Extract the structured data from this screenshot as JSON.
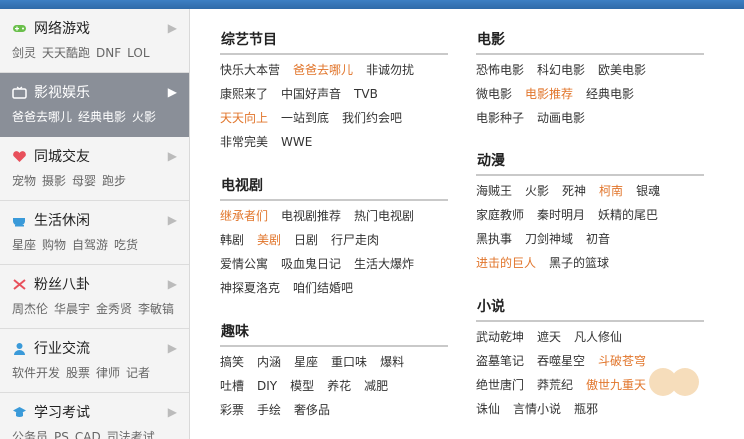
{
  "sidebar": {
    "items": [
      {
        "title": "网络游戏",
        "links": [
          "剑灵",
          "天天酷跑",
          "DNF",
          "LOL"
        ],
        "icon": "gamepad-icon",
        "color": "#6abf4b"
      },
      {
        "title": "影视娱乐",
        "links": [
          "爸爸去哪儿",
          "经典电影",
          "火影"
        ],
        "icon": "tv-icon",
        "color": "#ffffff"
      },
      {
        "title": "同城交友",
        "links": [
          "宠物",
          "摄影",
          "母婴",
          "跑步"
        ],
        "icon": "heart-icon",
        "color": "#e8505b"
      },
      {
        "title": "生活休闲",
        "links": [
          "星座",
          "购物",
          "自驾游",
          "吃货"
        ],
        "icon": "cup-icon",
        "color": "#3a9ad9"
      },
      {
        "title": "粉丝八卦",
        "links": [
          "周杰伦",
          "华晨宇",
          "金秀贤",
          "李敏镐"
        ],
        "icon": "cross-icon",
        "color": "#e8505b"
      },
      {
        "title": "行业交流",
        "links": [
          "软件开发",
          "股票",
          "律师",
          "记者"
        ],
        "icon": "person-icon",
        "color": "#3a9ad9"
      },
      {
        "title": "学习考试",
        "links": [
          "公务员",
          "PS",
          "CAD",
          "司法考试"
        ],
        "icon": "graduation-cap-icon",
        "color": "#3a9ad9"
      }
    ]
  },
  "sections": {
    "variety": {
      "title": "综艺节目",
      "rows": [
        [
          {
            "t": "快乐大本营"
          },
          {
            "t": "爸爸去哪儿",
            "hl": true
          },
          {
            "t": "非诚勿扰"
          }
        ],
        [
          {
            "t": "康熙来了"
          },
          {
            "t": "中国好声音"
          },
          {
            "t": "TVB"
          }
        ],
        [
          {
            "t": "天天向上",
            "hl": true
          },
          {
            "t": "一站到底"
          },
          {
            "t": "我们约会吧"
          }
        ],
        [
          {
            "t": "非常完美"
          },
          {
            "t": "WWE"
          }
        ]
      ]
    },
    "tvdrama": {
      "title": "电视剧",
      "rows": [
        [
          {
            "t": "继承者们",
            "hl": true
          },
          {
            "t": "电视剧推荐"
          },
          {
            "t": "热门电视剧"
          }
        ],
        [
          {
            "t": "韩剧"
          },
          {
            "t": "美剧",
            "hl": true
          },
          {
            "t": "日剧"
          },
          {
            "t": "行尸走肉"
          }
        ],
        [
          {
            "t": "爱情公寓"
          },
          {
            "t": "吸血鬼日记"
          },
          {
            "t": "生活大爆炸"
          }
        ],
        [
          {
            "t": "神探夏洛克"
          },
          {
            "t": "咱们结婚吧"
          }
        ]
      ]
    },
    "fun": {
      "title": "趣味",
      "rows": [
        [
          {
            "t": "搞笑"
          },
          {
            "t": "内涵"
          },
          {
            "t": "星座"
          },
          {
            "t": "重口味"
          },
          {
            "t": "爆料"
          }
        ],
        [
          {
            "t": "吐槽"
          },
          {
            "t": "DIY"
          },
          {
            "t": "模型"
          },
          {
            "t": "养花"
          },
          {
            "t": "减肥"
          }
        ],
        [
          {
            "t": "彩票"
          },
          {
            "t": "手绘"
          },
          {
            "t": "奢侈品"
          }
        ]
      ]
    },
    "movie": {
      "title": "电影",
      "rows": [
        [
          {
            "t": "恐怖电影"
          },
          {
            "t": "科幻电影"
          },
          {
            "t": "欧美电影"
          }
        ],
        [
          {
            "t": "微电影"
          },
          {
            "t": "电影推荐",
            "hl": true
          },
          {
            "t": "经典电影"
          }
        ],
        [
          {
            "t": "电影种子"
          },
          {
            "t": "动画电影"
          }
        ]
      ]
    },
    "anime": {
      "title": "动漫",
      "rows": [
        [
          {
            "t": "海贼王"
          },
          {
            "t": "火影"
          },
          {
            "t": "死神"
          },
          {
            "t": "柯南",
            "hl": true
          },
          {
            "t": "银魂"
          }
        ],
        [
          {
            "t": "家庭教师"
          },
          {
            "t": "秦时明月"
          },
          {
            "t": "妖精的尾巴"
          }
        ],
        [
          {
            "t": "黑执事"
          },
          {
            "t": "刀剑神域"
          },
          {
            "t": "初音"
          }
        ],
        [
          {
            "t": "进击的巨人",
            "hl": true
          },
          {
            "t": "黑子的篮球"
          }
        ]
      ]
    },
    "novel": {
      "title": "小说",
      "rows": [
        [
          {
            "t": "武动乾坤"
          },
          {
            "t": "遮天"
          },
          {
            "t": "凡人修仙"
          }
        ],
        [
          {
            "t": "盗墓笔记"
          },
          {
            "t": "吞噬星空"
          },
          {
            "t": "斗破苍穹",
            "hl": true
          }
        ],
        [
          {
            "t": "绝世唐门"
          },
          {
            "t": "莽荒纪"
          },
          {
            "t": "傲世九重天",
            "hl": true
          }
        ],
        [
          {
            "t": "诛仙"
          },
          {
            "t": "言情小说"
          },
          {
            "t": "瓶邪"
          }
        ]
      ]
    }
  }
}
